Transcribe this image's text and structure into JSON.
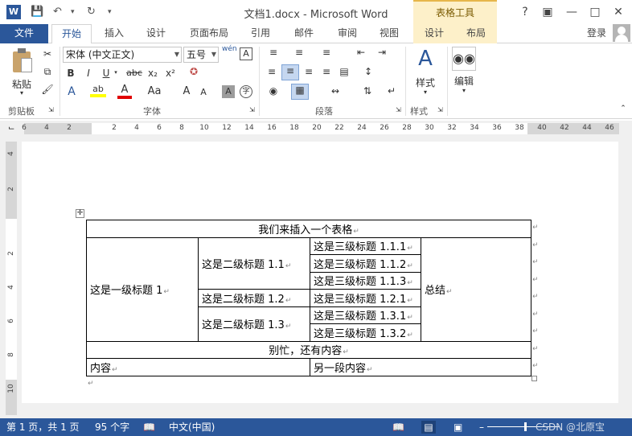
{
  "window": {
    "title": "文档1.docx - Microsoft Word",
    "table_tools_label": "表格工具",
    "help": "?",
    "login": "登录"
  },
  "tabs": [
    "文件",
    "开始",
    "插入",
    "设计",
    "页面布局",
    "引用",
    "邮件",
    "审阅",
    "视图",
    "设计",
    "布局"
  ],
  "ribbon": {
    "paste": "粘贴",
    "clipboard": "剪贴板",
    "font_name": "宋体 (中文正文)",
    "font_size": "五号",
    "font_group": "字体",
    "paragraph_group": "段落",
    "styles_button": "样式",
    "styles_group": "样式",
    "edit_button": "编辑",
    "bold": "B",
    "italic": "I",
    "underline": "U",
    "strike": "abc",
    "sub": "x₂",
    "sup": "x²",
    "wen": "wén"
  },
  "ruler_ticks": [
    "6",
    "4",
    "2",
    "2",
    "4",
    "6",
    "8",
    "10",
    "12",
    "14",
    "16",
    "18",
    "20",
    "22",
    "24",
    "26",
    "28",
    "30",
    "32",
    "34",
    "36",
    "38",
    "40",
    "42",
    "44",
    "46"
  ],
  "vruler_ticks": [
    "4",
    "2",
    "2",
    "4",
    "6",
    "8",
    "10"
  ],
  "table": {
    "header": "我们来插入一个表格",
    "l1": "这是一级标题 1",
    "l2_1": "这是二级标题 1.1",
    "l2_2": "这是二级标题 1.2",
    "l2_3": "这是二级标题 1.3",
    "l3": [
      "这是三级标题 1.1.1",
      "这是三级标题 1.1.2",
      "这是三级标题 1.1.3",
      "这是三级标题 1.2.1",
      "这是三级标题 1.3.1",
      "这是三级标题 1.3.2"
    ],
    "summary": "总结",
    "footer": "别忙，还有内容",
    "content": "内容",
    "other": "另一段内容"
  },
  "status": {
    "page": "第 1 页，共 1 页",
    "words": "95 个字",
    "lang": "中文(中国)",
    "watermark": "CSDN @北原宝"
  }
}
